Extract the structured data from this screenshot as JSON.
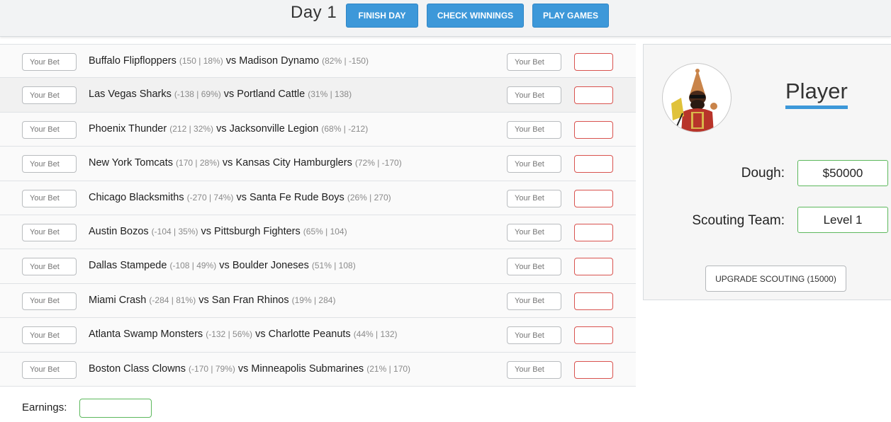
{
  "header": {
    "day_label": "Day 1",
    "finish_day": "FINISH DAY",
    "check_winnings": "CHECK WINNINGS",
    "play_games": "PLAY GAMES"
  },
  "bet_placeholder": "Your Bet",
  "games": [
    {
      "team1": "Buffalo Flipfloppers",
      "odds1": "(150 | 18%)",
      "vs": "vs",
      "team2": "Madison Dynamo",
      "odds2": "(82% | -150)"
    },
    {
      "team1": "Las Vegas Sharks",
      "odds1": "(-138 | 69%)",
      "vs": "vs",
      "team2": "Portland Cattle",
      "odds2": "(31% | 138)"
    },
    {
      "team1": "Phoenix Thunder",
      "odds1": "(212 | 32%)",
      "vs": "vs",
      "team2": "Jacksonville Legion",
      "odds2": "(68% | -212)"
    },
    {
      "team1": "New York Tomcats",
      "odds1": "(170 | 28%)",
      "vs": "vs",
      "team2": "Kansas City Hamburglers",
      "odds2": "(72% | -170)"
    },
    {
      "team1": "Chicago Blacksmiths",
      "odds1": "(-270 | 74%)",
      "vs": "vs",
      "team2": "Santa Fe Rude Boys",
      "odds2": "(26% | 270)"
    },
    {
      "team1": "Austin Bozos",
      "odds1": "(-104 | 35%)",
      "vs": "vs",
      "team2": "Pittsburgh Fighters",
      "odds2": "(65% | 104)"
    },
    {
      "team1": "Dallas Stampede",
      "odds1": "(-108 | 49%)",
      "vs": "vs",
      "team2": "Boulder Joneses",
      "odds2": "(51% | 108)"
    },
    {
      "team1": "Miami Crash",
      "odds1": "(-284 | 81%)",
      "vs": "vs",
      "team2": "San Fran Rhinos",
      "odds2": "(19% | 284)"
    },
    {
      "team1": "Atlanta Swamp Monsters",
      "odds1": "(-132 | 56%)",
      "vs": "vs",
      "team2": "Charlotte Peanuts",
      "odds2": "(44% | 132)"
    },
    {
      "team1": "Boston Class Clowns",
      "odds1": "(-170 | 79%)",
      "vs": "vs",
      "team2": "Minneapolis Submarines",
      "odds2": "(21% | 170)"
    }
  ],
  "earnings": {
    "label": "Earnings:",
    "value": ""
  },
  "player": {
    "name": "Player",
    "dough_label": "Dough:",
    "dough_value": "$50000",
    "scouting_label": "Scouting Team:",
    "scouting_value": "Level 1",
    "upgrade_button": "UPGRADE SCOUTING (15000)"
  },
  "colors": {
    "accent": "#3d98d9",
    "success": "#5cb85c",
    "danger": "#d9534f"
  }
}
